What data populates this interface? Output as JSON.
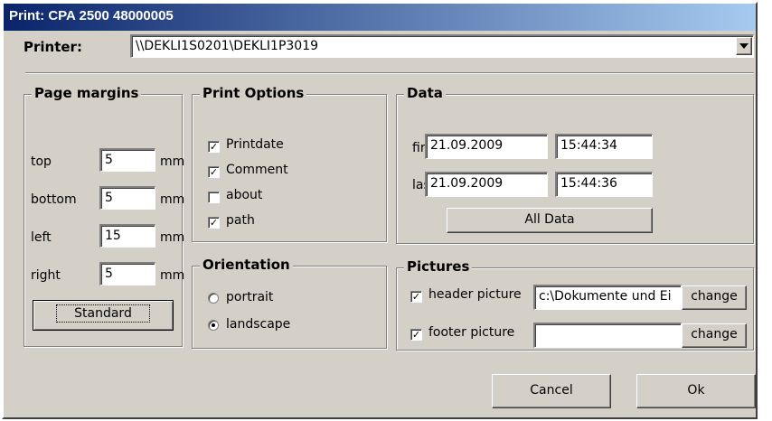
{
  "window": {
    "title": "Print: CPA 2500 48000005"
  },
  "printer": {
    "label": "Printer:",
    "value": "\\\\DEKLI1S0201\\DEKLI1P3019",
    "dropdown_icon": "chevron-down-icon"
  },
  "margins": {
    "title": "Page margins",
    "rows": [
      {
        "label": "top",
        "value": "5",
        "unit": "mm"
      },
      {
        "label": "bottom",
        "value": "5",
        "unit": "mm"
      },
      {
        "label": "left",
        "value": "15",
        "unit": "mm"
      },
      {
        "label": "right",
        "value": "5",
        "unit": "mm"
      }
    ],
    "standard_label": "Standard"
  },
  "print_options": {
    "title": "Print Options",
    "items": [
      {
        "label": "Printdate",
        "checked": true
      },
      {
        "label": "Comment",
        "checked": true
      },
      {
        "label": "about",
        "checked": false
      },
      {
        "label": "path",
        "checked": true
      }
    ]
  },
  "orientation": {
    "title": "Orientation",
    "options": [
      {
        "label": "portrait",
        "selected": false
      },
      {
        "label": "landscape",
        "selected": true
      }
    ]
  },
  "data": {
    "title": "Data",
    "first_label": "first",
    "first_date": "21.09.2009",
    "first_time": "15:44:34",
    "last_label": "last",
    "last_date": "21.09.2009",
    "last_time": "15:44:36",
    "all_data_label": "All Data"
  },
  "pictures": {
    "title": "Pictures",
    "header_label": "header picture",
    "header_checked": true,
    "header_value": "c:\\Dokumente und Ei",
    "footer_label": "footer picture",
    "footer_checked": true,
    "footer_value": "",
    "change_label": "change"
  },
  "buttons": {
    "cancel": "Cancel",
    "ok": "Ok"
  }
}
